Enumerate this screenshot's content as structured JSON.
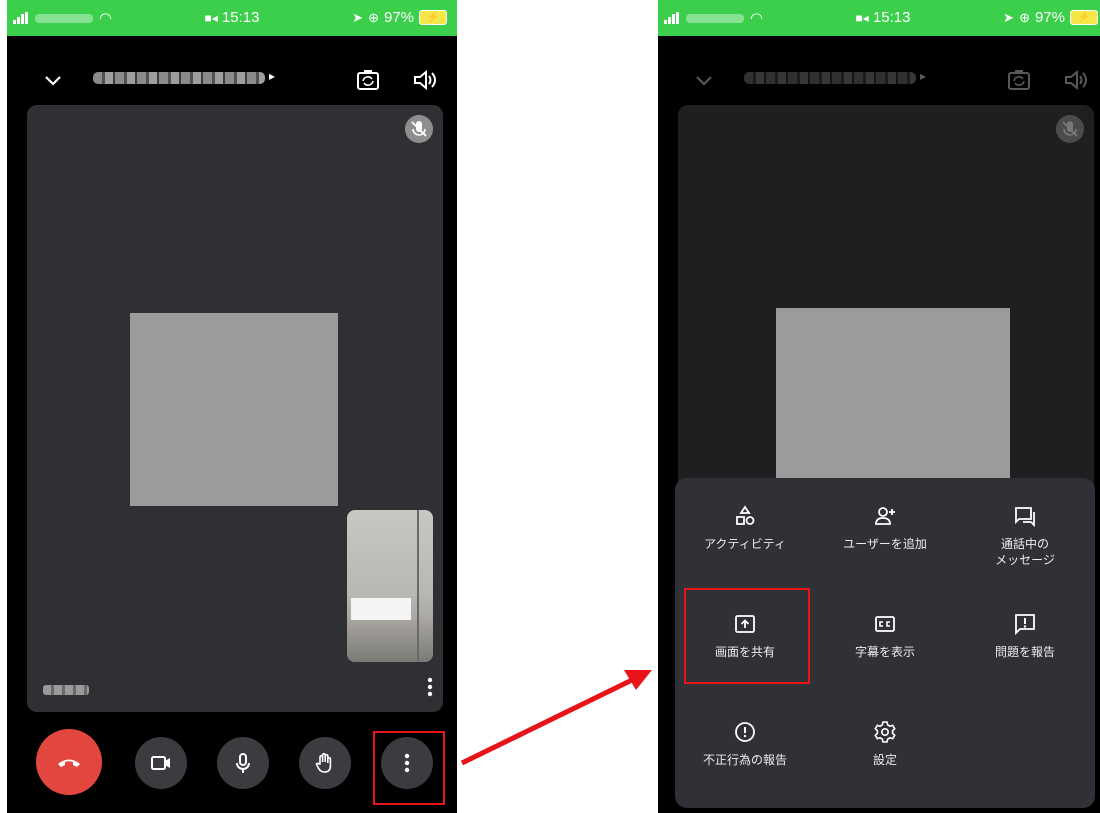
{
  "status_bar": {
    "time": "15:13",
    "battery": "97%",
    "camera_indicator": "■◂"
  },
  "meeting": {
    "room_caret": "▸"
  },
  "menu": {
    "items": [
      {
        "label": "アクティビティ",
        "icon": "activities-icon"
      },
      {
        "label": "ユーザーを追加",
        "icon": "add-person-icon"
      },
      {
        "label": "通話中の\nメッセージ",
        "icon": "chat-icon"
      },
      {
        "label": "画面を共有",
        "icon": "screen-share-icon"
      },
      {
        "label": "字幕を表示",
        "icon": "captions-icon"
      },
      {
        "label": "問題を報告",
        "icon": "feedback-icon"
      },
      {
        "label": "不正行為の報告",
        "icon": "report-abuse-icon"
      },
      {
        "label": "設定",
        "icon": "settings-icon"
      }
    ]
  },
  "colors": {
    "status_bar": "#3bcf4c",
    "end_call": "#e2463f",
    "highlight": "#e8141a",
    "sheet": "#2f3136",
    "tile": "#2f3033"
  }
}
